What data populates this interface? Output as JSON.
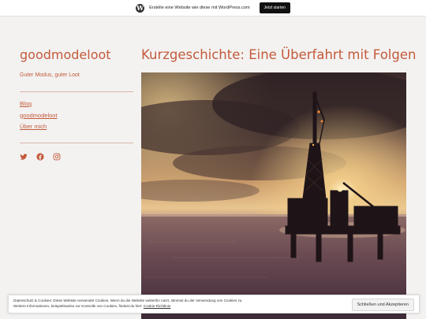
{
  "topbar": {
    "text": "Erstelle eine Website wie diese mit WordPress.com",
    "button": "Jetzt starten"
  },
  "site": {
    "title": "goodmodeloot",
    "tagline": "Guter Modus, guter Loot"
  },
  "nav": {
    "items": [
      {
        "label": "Blog"
      },
      {
        "label": "goodmodeloot"
      },
      {
        "label": "Über mich"
      }
    ]
  },
  "social": {
    "icons": [
      "twitter-icon",
      "facebook-icon",
      "instagram-icon"
    ]
  },
  "post": {
    "title": "Kurzgeschichte: Eine Überfahrt mit Folgen"
  },
  "cookie": {
    "line1": "Datenschutz & Cookies: Diese Website verwendet Cookies. Wenn du die Website weiterhin nutzt, stimmst du der Verwendung von Cookies zu.",
    "line2": "Weitere Informationen, beispielsweise zur Kontrolle von Cookies, findest du hier: ",
    "link": "Cookie-Richtlinie",
    "button": "Schließen und Akzeptieren"
  },
  "colors": {
    "accent": "#c45a3b",
    "background": "#f3f2f1"
  }
}
